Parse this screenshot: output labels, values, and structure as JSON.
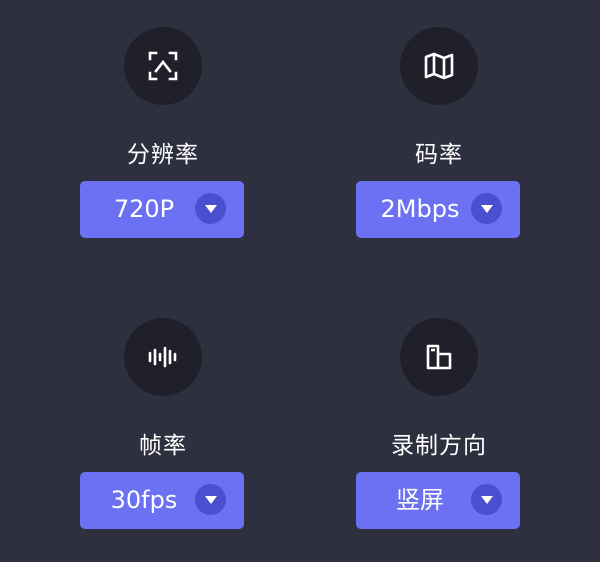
{
  "settings": [
    {
      "label": "分辨率",
      "value": "720P",
      "icon": "scan-icon"
    },
    {
      "label": "码率",
      "value": "2Mbps",
      "icon": "map-icon"
    },
    {
      "label": "帧率",
      "value": "30fps",
      "icon": "waveform-icon"
    },
    {
      "label": "录制方向",
      "value": "竖屏",
      "icon": "screen-orientation-icon"
    }
  ],
  "colors": {
    "background": "#2e3040",
    "icon_circle": "#1f2029",
    "dropdown": "#6b71f2",
    "dropdown_chevron": "#4a4fcf",
    "text": "#ffffff"
  }
}
